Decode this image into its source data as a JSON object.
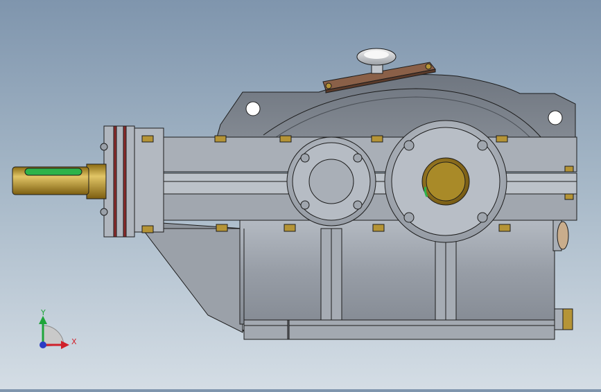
{
  "view": {
    "background_top": "#7f95ad",
    "background_bottom": "#d4dde5"
  },
  "model": {
    "housing_color": "#9aa1aa",
    "housing_shadow": "#6b7078",
    "housing_edge": "#1c1c1c",
    "shaft_color": "#b8912a",
    "key_color": "#2db34a",
    "bolt_color": "#b59436",
    "cover_plate_color": "#8a6048",
    "seal_color": "#8a2a2a",
    "bushing_color": "#9c7a22"
  },
  "triad": {
    "icon": "xyz-axis-triad-icon",
    "x_label": "X",
    "y_label": "Y",
    "x_color": "#d0202a",
    "y_color": "#1fa53a",
    "z_color": "#2a3bc4"
  }
}
